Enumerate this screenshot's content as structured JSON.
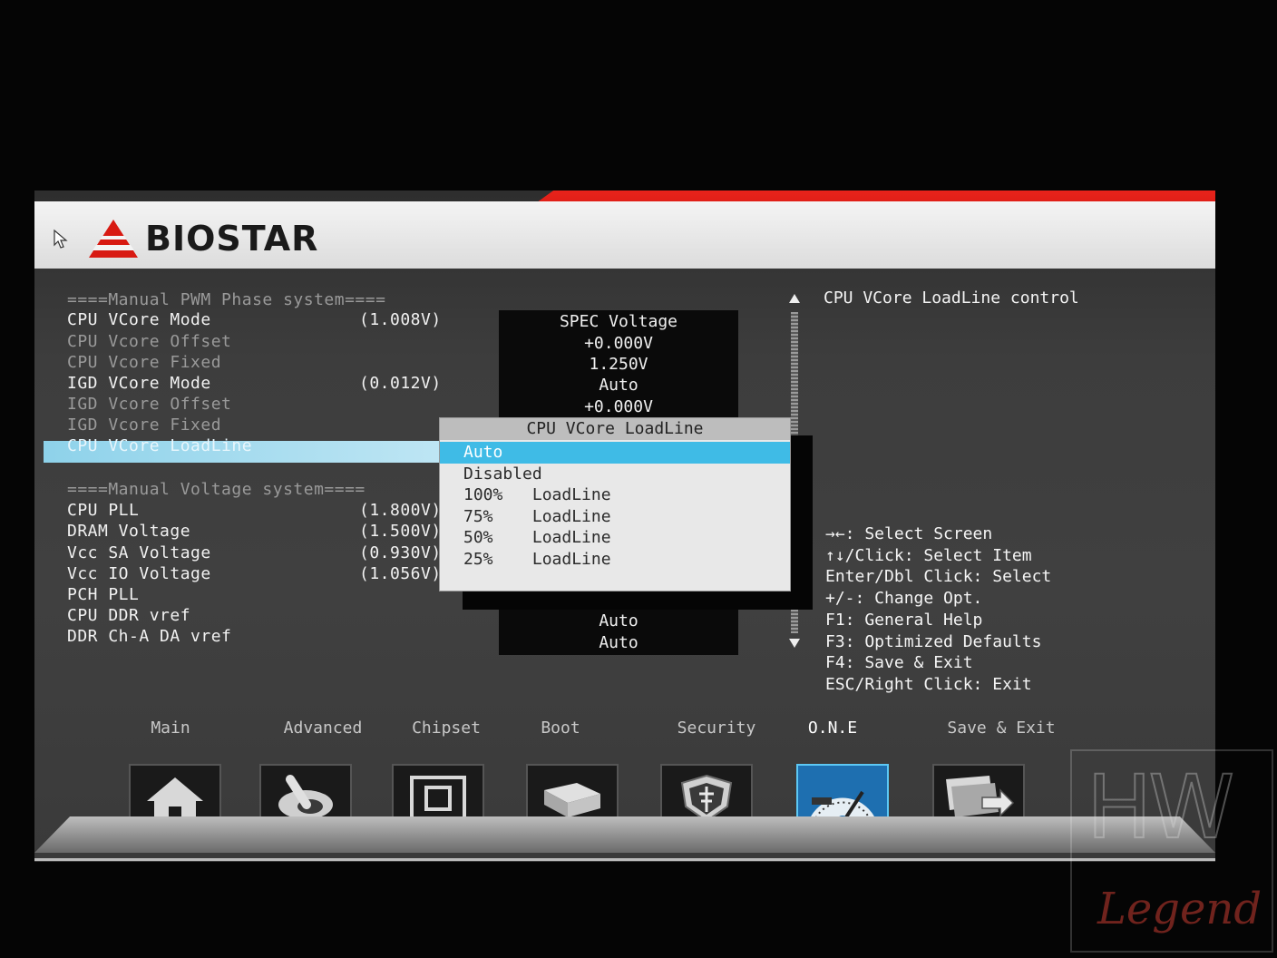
{
  "brand": {
    "name": "BIOSTAR"
  },
  "menu": {
    "rows": [
      {
        "label": "====Manual PWM Phase system====",
        "value": "",
        "dim": true
      },
      {
        "label": "CPU VCore Mode",
        "value": "(1.008V)",
        "dim": false
      },
      {
        "label": "CPU Vcore Offset",
        "value": "",
        "dim": true
      },
      {
        "label": "CPU Vcore Fixed",
        "value": "",
        "dim": true
      },
      {
        "label": "IGD VCore Mode",
        "value": "(0.012V)",
        "dim": false
      },
      {
        "label": "IGD Vcore Offset",
        "value": "",
        "dim": true
      },
      {
        "label": "IGD Vcore Fixed",
        "value": "",
        "dim": true
      },
      {
        "label": "CPU VCore LoadLine",
        "value": "",
        "dim": true
      },
      {
        "label": "====Manual Voltage system====",
        "value": "",
        "dim": true
      },
      {
        "label": "CPU PLL",
        "value": "(1.800V)",
        "dim": false
      },
      {
        "label": "DRAM Voltage",
        "value": "(1.500V)",
        "dim": false
      },
      {
        "label": "Vcc SA Voltage",
        "value": "(0.930V)",
        "dim": false
      },
      {
        "label": "Vcc IO Voltage",
        "value": "(1.056V)",
        "dim": false
      },
      {
        "label": "PCH PLL",
        "value": "",
        "dim": false
      },
      {
        "label": "CPU DDR vref",
        "value": "",
        "dim": false
      },
      {
        "label": "DDR Ch-A DA vref",
        "value": "",
        "dim": false
      }
    ],
    "selected_index": 7
  },
  "settings_column": {
    "items": [
      "SPEC Voltage",
      "+0.000V",
      "1.250V",
      "Auto",
      "+0.000V",
      "Auto",
      "Auto",
      "Auto"
    ]
  },
  "popup": {
    "title": "CPU VCore LoadLine",
    "options": [
      "Auto",
      "Disabled",
      "100%   LoadLine",
      "75%    LoadLine",
      "50%    LoadLine",
      "25%    LoadLine"
    ],
    "selected_index": 0
  },
  "help": {
    "title": "CPU VCore LoadLine control",
    "keys": [
      "→←: Select Screen",
      "↑↓/Click: Select Item",
      "Enter/Dbl Click: Select",
      "+/-: Change Opt.",
      "F1: General Help",
      "F3: Optimized Defaults",
      "F4: Save & Exit",
      "ESC/Right Click: Exit"
    ]
  },
  "tabs": [
    {
      "label": "Main",
      "icon": "home-icon",
      "active": false
    },
    {
      "label": "Advanced",
      "icon": "joystick-icon",
      "active": false
    },
    {
      "label": "Chipset",
      "icon": "chip-icon",
      "active": false
    },
    {
      "label": "Boot",
      "icon": "drives-icon",
      "active": false
    },
    {
      "label": "Security",
      "icon": "shield-icon",
      "active": false
    },
    {
      "label": "O.N.E",
      "icon": "speedometer-icon",
      "active": true
    },
    {
      "label": "Save & Exit",
      "icon": "save-exit-icon",
      "active": false
    }
  ],
  "watermark": {
    "top": "HW",
    "bottom": "Legend"
  },
  "colors": {
    "accent": "#3fbbe6",
    "brand_red": "#d81a12",
    "selection": "#8ed2ea"
  }
}
